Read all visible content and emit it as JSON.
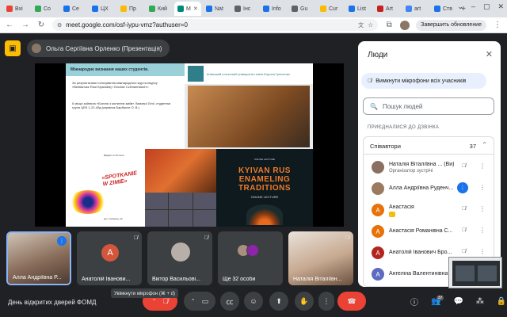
{
  "browser": {
    "tabs": [
      {
        "label": "Вхі",
        "color": "#ea4335"
      },
      {
        "label": "Co",
        "color": "#34a853"
      },
      {
        "label": "Се",
        "color": "#1a73e8"
      },
      {
        "label": "ЦХ",
        "color": "#1a73e8"
      },
      {
        "label": "Пр",
        "color": "#fbbc04"
      },
      {
        "label": "Кий",
        "color": "#34a853"
      },
      {
        "label": "М",
        "color": "#00897b",
        "active": true
      },
      {
        "label": "Nat",
        "color": "#1a73e8"
      },
      {
        "label": "Інс",
        "color": "#5f6368"
      },
      {
        "label": "Info",
        "color": "#1a73e8"
      },
      {
        "label": "Gu",
        "color": "#5f6368"
      },
      {
        "label": "Cur",
        "color": "#fbbc04"
      },
      {
        "label": "List",
        "color": "#1a73e8"
      },
      {
        "label": "Art",
        "color": "#c5221f"
      },
      {
        "label": "art",
        "color": "#4285f4"
      },
      {
        "label": "Ств",
        "color": "#1a73e8"
      }
    ],
    "url": "meet.google.com/osf-iypu-vmz?authuser=0",
    "update_label": "Завершить обновление",
    "icons": [
      "back-icon",
      "forward-icon",
      "reload-icon",
      "site-info-icon",
      "translate-icon",
      "bookmark-star-icon",
      "extensions-icon",
      "profile-icon",
      "menu-icon"
    ]
  },
  "meet": {
    "presenter_label": "Ольга Сергіївна Орленко (Презентація)",
    "slide": {
      "banner": "Міжнародне визнання наших студентів.",
      "uni_name": "Київський столичний університет імені Бориса Грінченка",
      "text1": "За результатами голосування міжнародного журі конкурсу «Bestiariusz Rusi Kijowskiej i Grodów Czerwieńskich»:",
      "text2": "ІІ місце зайняла «Богиня з мотилем зміїв» Лимової Лілії, студентки групи ЦЕБ 1-22-4бд (керівник Барбалат О. В.)",
      "poster_title": "«SPOTKANIE W ZIMIE»",
      "poster_small1": "Відкриття 15 січня",
      "poster_small2": "вул. Соборна, 24",
      "kyiv_sub": "ONLINE LECTURE",
      "kyiv_title": "KYIVAN RUS ENAMELING TRADITIONS",
      "kyiv_online": "ONLINE LECTURE"
    },
    "tiles": [
      {
        "name": "Алла Андріївна Р...",
        "type": "photo",
        "speaking": true
      },
      {
        "name": "Анатолій Іванови...",
        "letter": "А",
        "color": "#d2563b"
      },
      {
        "name": "Віктор Васильові...",
        "type": "photo"
      },
      {
        "name": "Ще 32 особи",
        "type": "more"
      },
      {
        "name": "Наталія Віталіївн...",
        "type": "photo"
      }
    ],
    "tooltip": "Увімкнути мікрофон (⌘ + d)",
    "meeting_title": "День відкритих дверей ФОМД",
    "participants_count": "37",
    "people_panel": {
      "title": "Люди",
      "mute_all": "Вимкнути мікрофони всіх учасників",
      "search_placeholder": "Пошук людей",
      "joined_label": "ПРИЄДНАЛИСЯ ДО ДЗВІНКА",
      "group_name": "Співавтори",
      "group_count": "37",
      "people": [
        {
          "name": "Наталія Віталіївна ... (Ви)",
          "role": "Організатор зустрічі",
          "avatar_color": "#8a7060",
          "mic": "muted"
        },
        {
          "name": "Алла Андріївна Руденч...",
          "avatar_color": "#9a7a60",
          "mic": "speaking"
        },
        {
          "name": "Анастасія",
          "letter": "А",
          "avatar_color": "#e8710a",
          "hand": true,
          "mic": "muted"
        },
        {
          "name": "Анастасія Романівна С...",
          "letter": "А",
          "avatar_color": "#e8710a",
          "mic": "muted"
        },
        {
          "name": "Анатолій Іванович Бро...",
          "letter": "А",
          "avatar_color": "#b3261e",
          "mic": "muted"
        },
        {
          "name": "Ангеліна Валентинівна",
          "letter": "А",
          "avatar_color": "#5c6bc0",
          "mic": "muted"
        }
      ]
    }
  }
}
